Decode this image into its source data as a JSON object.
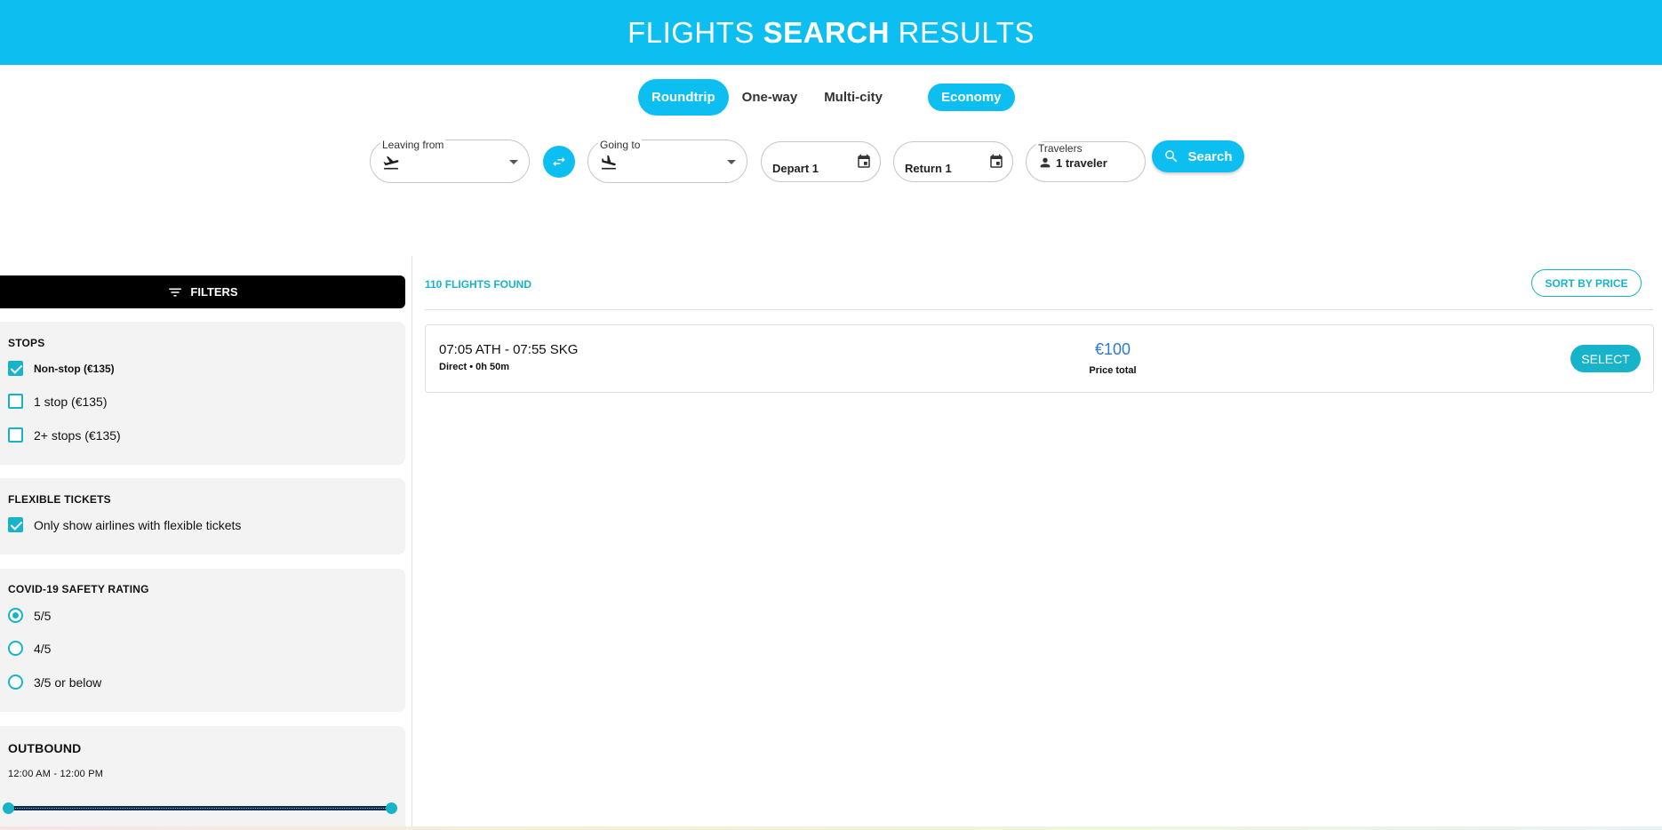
{
  "header": {
    "title_pre": "FLIGHTS",
    "title_bold": "SEARCH",
    "title_post": "RESULTS"
  },
  "trip_types": [
    {
      "label": "Roundtrip",
      "active": true
    },
    {
      "label": "One-way",
      "active": false
    },
    {
      "label": "Multi-city",
      "active": false
    }
  ],
  "cabin_class": "Economy",
  "search": {
    "leaving_label": "Leaving from",
    "going_label": "Going to",
    "depart_value": "Depart 1",
    "return_value": "Return 1",
    "travelers_label": "Travelers",
    "travelers_value": "1 traveler",
    "search_label": "Search"
  },
  "filters": {
    "bar_label": "FILTERS",
    "stops": {
      "title": "STOPS",
      "options": [
        {
          "label": "Non-stop (€135)",
          "checked": true
        },
        {
          "label": "1 stop (€135)",
          "checked": false
        },
        {
          "label": "2+ stops (€135)",
          "checked": false
        }
      ]
    },
    "flexible": {
      "title": "FLEXIBLE TICKETS",
      "option": "Only show airlines with flexible tickets",
      "checked": true
    },
    "covid": {
      "title": "COVID-19 SAFETY RATING",
      "options": [
        {
          "label": "5/5",
          "checked": true
        },
        {
          "label": "4/5",
          "checked": false
        },
        {
          "label": "3/5 or below",
          "checked": false
        }
      ]
    },
    "outbound": {
      "title": "OUTBOUND",
      "range": "12:00 AM - 12:00 PM"
    }
  },
  "results": {
    "count_label": "110 FLIGHTS FOUND",
    "sort_label": "SORT BY PRICE",
    "flights": [
      {
        "times": "07:05 ATH - 07:55 SKG",
        "meta": "Direct • 0h 50m",
        "price": "€100",
        "price_label": "Price total",
        "select_label": "SELECT"
      }
    ]
  },
  "colors": {
    "primary": "#0dbff0",
    "accent": "#17b3c9",
    "price": "#2b7bd2"
  },
  "icons": [
    "flight-takeoff-icon",
    "flight-land-icon",
    "swap-icon",
    "calendar-icon",
    "person-icon",
    "search-icon",
    "filter-icon"
  ]
}
